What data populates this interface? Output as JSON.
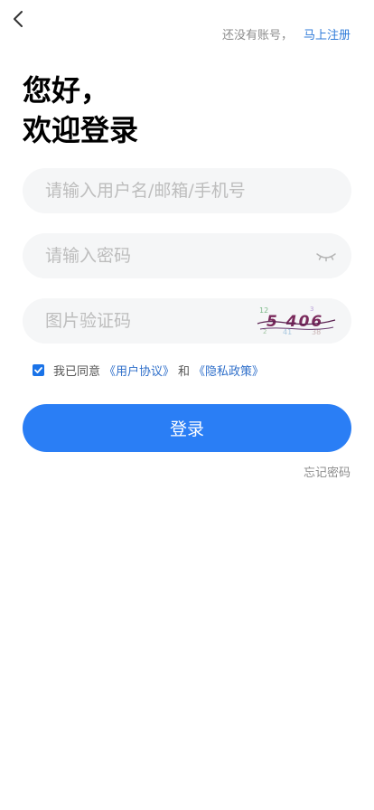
{
  "topbar": {
    "back_icon": "chevron-left-icon",
    "no_account_hint": "还没有账号，",
    "register_link": "马上注册"
  },
  "greeting": {
    "line1": "您好，",
    "line2": "欢迎登录"
  },
  "form": {
    "username_placeholder": "请输入用户名/邮箱/手机号",
    "password_placeholder": "请输入密码",
    "password_toggle_icon": "eye-closed-icon",
    "captcha_placeholder": "图片验证码",
    "captcha_text": "5 406"
  },
  "agreement": {
    "checked": true,
    "prefix": "我已同意",
    "user_agreement": "《用户协议》",
    "and": "和",
    "privacy_policy": "《隐私政策》"
  },
  "login_button": "登录",
  "forgot_password": "忘记密码",
  "colors": {
    "primary": "#2a7ef5",
    "link": "#2f7bd9",
    "field_bg": "#f5f6f7"
  }
}
